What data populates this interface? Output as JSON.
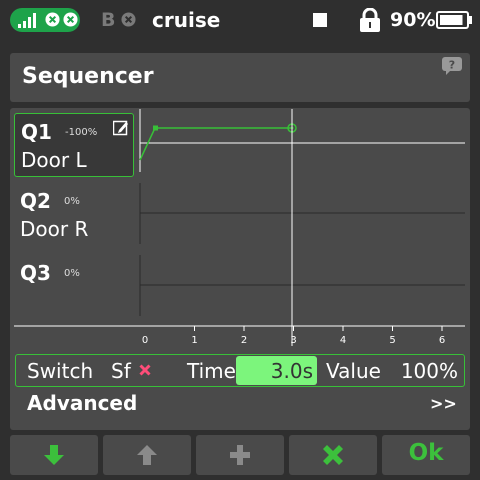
{
  "status": {
    "model_name": "cruise",
    "b_label": "B",
    "battery_percent": "90%",
    "battery_level": 0.9,
    "signal_bars": 4
  },
  "page": {
    "title": "Sequencer"
  },
  "sequencer": {
    "items": [
      {
        "name": "Q1",
        "value": "-100%",
        "label": "Door L"
      },
      {
        "name": "Q2",
        "value": "0%",
        "label": "Door R"
      },
      {
        "name": "Q3",
        "value": "0%",
        "label": ""
      }
    ],
    "x_ticks": [
      "0",
      "1",
      "2",
      "3",
      "4",
      "5",
      "6"
    ],
    "cursor_x": 3.0,
    "q1_curve": [
      [
        0,
        -100
      ],
      [
        0.2,
        35
      ],
      [
        3.0,
        35
      ]
    ]
  },
  "settings": {
    "switch_label": "Switch",
    "switch_value": "Sf",
    "time_label": "Time",
    "time_value": "3.0s",
    "value_label": "Value",
    "value_value": "100%"
  },
  "advanced": {
    "label": "Advanced",
    "more": ">>"
  },
  "buttons": {
    "ok_label": "Ok"
  },
  "colors": {
    "accent": "#38c038",
    "highlight": "#7cf57c",
    "danger": "#ff4d79"
  }
}
